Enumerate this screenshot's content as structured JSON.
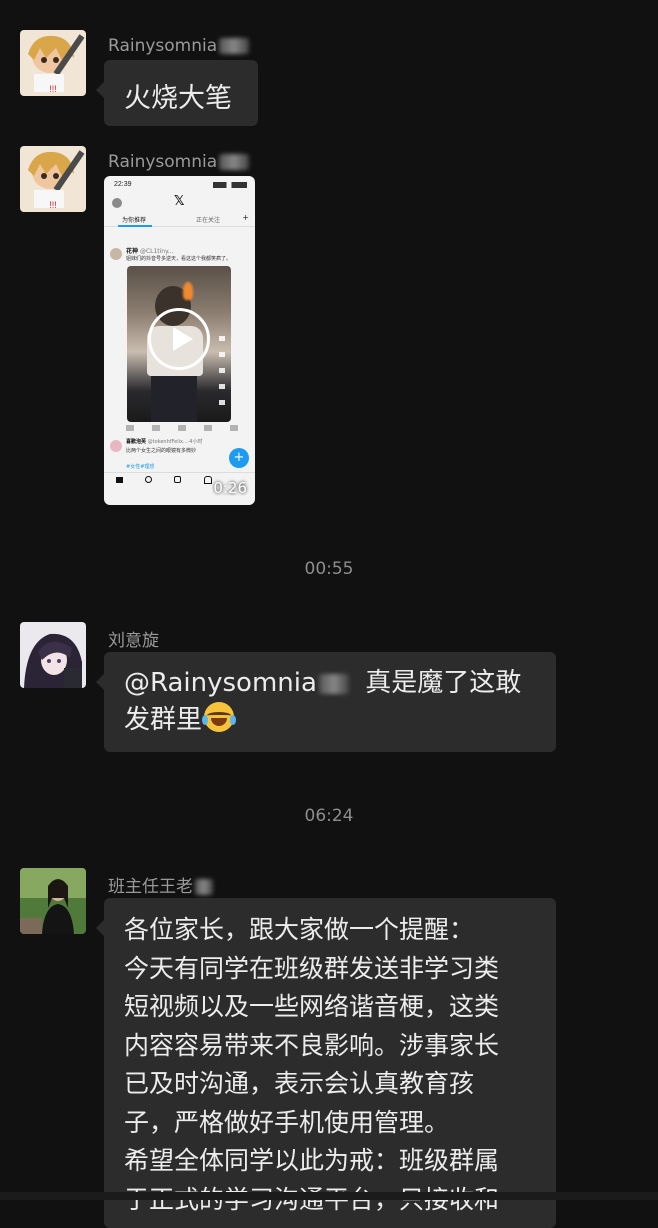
{
  "messages": [
    {
      "sender": "Rainysomnia",
      "text": "火烧大笔"
    },
    {
      "sender": "Rainysomnia",
      "video": {
        "status_time": "22:39",
        "tab_left": "为你推荐",
        "tab_right": "正在关注",
        "post_user": "花神",
        "post_handle": "@CL1tiny...",
        "post_text": "姐妹们的抖音号多逆天，看这这个我都笑疯了。",
        "reply_user": "喜歡泡芙",
        "reply_handle": "@tokenhfFelix...·4小时",
        "reply_text": "比两个女生之间的眼镜有多微妙",
        "hashtag": "#女性#理想",
        "duration": "0:26"
      }
    },
    {
      "time": "00:55"
    },
    {
      "sender": "刘意旋",
      "text_mention": "@Rainysomnia",
      "text_rest": "真是魔了这敢",
      "text_line2": "发群里"
    },
    {
      "time": "06:24"
    },
    {
      "sender": "班主任王老",
      "lines": [
        "各位家长，跟大家做一个提醒：",
        "今天有同学在班级群发送非学习类",
        "短视频以及一些网络谐音梗，这类",
        "内容容易带来不良影响。涉事家长",
        "已及时沟通，表示会认真教育孩",
        "子，严格做好手机使用管理。",
        "希望全体同学以此为戒：班级群属",
        "于正式的学习沟通平台，只接收和"
      ]
    }
  ],
  "colors": {
    "background": "#111111",
    "bubble": "#2c2c2c",
    "sender": "#9a9a9a",
    "time": "#8d8d8d",
    "play": "#ffffff"
  },
  "icons": [
    "play-icon",
    "x-logo-icon",
    "compose-fab-icon",
    "laugh-cry-emoji-icon"
  ]
}
